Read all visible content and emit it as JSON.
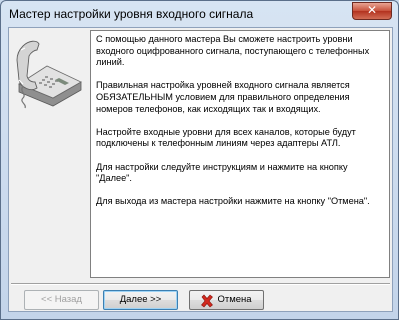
{
  "window": {
    "title": "Мастер настройки уровня входного сигнала",
    "close_label": "✕"
  },
  "description": {
    "paragraphs": [
      "С помощью данного мастера Вы сможете настроить уровни входного оцифрованного сигнала, поступающего с телефонных линий.",
      "Правильная настройка уровней входного сигнала является ОБЯЗАТЕЛЬНЫМ условием для правильного определения номеров телефонов, как исходящих так и входящих.",
      "Настройте входные уровни для всех каналов, которые будут подключены к телефонным линиям через адаптеры АТЛ.",
      "Для настройки следуйте инструкциям и нажмите на кнопку \"Далее\".",
      "Для выхода из мастера настройки нажмите на кнопку \"Отмена\"."
    ]
  },
  "buttons": {
    "back_label": "<< Назад",
    "next_label": "Далее >>",
    "cancel_label": "Отмена"
  },
  "icons": {
    "illustration": "telephone-icon",
    "cancel": "red-x-icon"
  },
  "colors": {
    "cancel_icon": "#d22a1f",
    "close_button": "#c7503a"
  }
}
